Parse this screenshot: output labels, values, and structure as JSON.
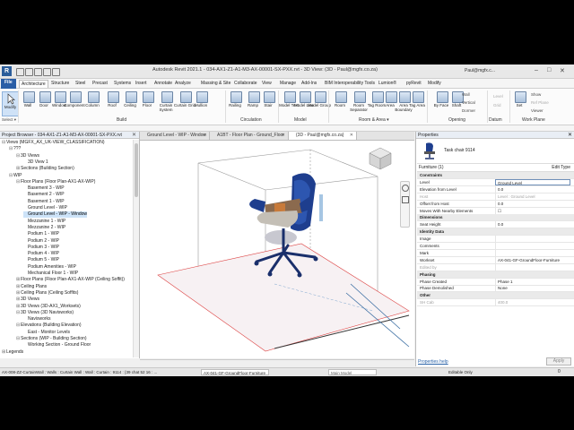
{
  "window": {
    "title": "Autodesk Revit 2021.1 - 034-AX1-Z1-A1-M3-AX-00001-SX-PXX.rvt - 3D View: (3D - Paul@mgfx.co.za)",
    "user": "Paul@mgfx.c...",
    "app_icon": "R"
  },
  "ribbon": {
    "tabs": [
      "File",
      "Architecture",
      "Structure",
      "Steel",
      "Precast",
      "Systems",
      "Insert",
      "Annotate",
      "Analyze",
      "Massing & Site",
      "Collaborate",
      "View",
      "Manage",
      "Add-Ins",
      "BIM Interoperability Tools",
      "Lumion®",
      "pyRevit",
      "Modify"
    ],
    "active_tab": "Architecture",
    "modify": "Modify",
    "select": "Select ▾",
    "buttons": [
      {
        "label": "Wall"
      },
      {
        "label": "Door"
      },
      {
        "label": "Window"
      },
      {
        "label": "Component"
      },
      {
        "label": "Column"
      },
      {
        "label": "Roof"
      },
      {
        "label": "Ceiling"
      },
      {
        "label": "Floor"
      },
      {
        "label": "Curtain System"
      },
      {
        "label": "Curtain Grid"
      },
      {
        "label": "Mullion"
      },
      {
        "label": "Railing"
      },
      {
        "label": "Ramp"
      },
      {
        "label": "Stair"
      },
      {
        "label": "Model Text"
      },
      {
        "label": "Model Line"
      },
      {
        "label": "Model Group"
      },
      {
        "label": "Room"
      },
      {
        "label": "Room Separator"
      },
      {
        "label": "Tag Room"
      },
      {
        "label": "Area"
      },
      {
        "label": "Area Boundary"
      },
      {
        "label": "Tag Area"
      },
      {
        "label": "By Face"
      },
      {
        "label": "Shaft"
      }
    ],
    "opening_small": [
      "Wall",
      "Vertical",
      "Dormer"
    ],
    "datum_small": [
      "Level",
      "Grid"
    ],
    "workplane_small": [
      "Show",
      "Ref Plane",
      "Viewer"
    ],
    "set_label": "Set",
    "panels": [
      "Build",
      "Circulation",
      "Model",
      "Room & Area ▾",
      "Opening",
      "Datum",
      "Work Plane"
    ]
  },
  "browser": {
    "title": "Project Browser - 034-AX1-Z1-A1-M3-AX-00001-SX-PXX.rvt",
    "tree": [
      {
        "label": "Views (MGFX_AX_UK-VIEW_CLASSIFICATION)",
        "indent": 0,
        "tog": "⊟"
      },
      {
        "label": "???",
        "indent": 1,
        "tog": "⊟"
      },
      {
        "label": "3D Views",
        "indent": 2,
        "tog": "⊟"
      },
      {
        "label": "3D View 1",
        "indent": 3,
        "tog": ""
      },
      {
        "label": "Sections (Building Section)",
        "indent": 2,
        "tog": "⊞"
      },
      {
        "label": "WIP",
        "indent": 1,
        "tog": "⊟"
      },
      {
        "label": "Floor Plans (Floor Plan-AX1-AX-WIP)",
        "indent": 2,
        "tog": "⊟"
      },
      {
        "label": "Basement 3 - WIP",
        "indent": 3,
        "tog": ""
      },
      {
        "label": "Basement 2 - WIP",
        "indent": 3,
        "tog": ""
      },
      {
        "label": "Basement 1 - WIP",
        "indent": 3,
        "tog": ""
      },
      {
        "label": "Ground Level - WIP",
        "indent": 3,
        "tog": ""
      },
      {
        "label": "Ground Level - WIP - Window",
        "indent": 3,
        "tog": "",
        "sel": true
      },
      {
        "label": "Mezzanine 1 - WIP",
        "indent": 3,
        "tog": ""
      },
      {
        "label": "Mezzanine 2 - WIP",
        "indent": 3,
        "tog": ""
      },
      {
        "label": "Podium 1 - WIP",
        "indent": 3,
        "tog": ""
      },
      {
        "label": "Podium 2 - WIP",
        "indent": 3,
        "tog": ""
      },
      {
        "label": "Podium 3 - WIP",
        "indent": 3,
        "tog": ""
      },
      {
        "label": "Podium 4 - WIP",
        "indent": 3,
        "tog": ""
      },
      {
        "label": "Podium 5 - WIP",
        "indent": 3,
        "tog": ""
      },
      {
        "label": "Podium Amenities - WIP",
        "indent": 3,
        "tog": ""
      },
      {
        "label": "Mechanical Floor 1 - WIP",
        "indent": 3,
        "tog": ""
      },
      {
        "label": "Floor Plans (Floor Plan-AX1-AX-WIP (Ceiling Soffit))",
        "indent": 2,
        "tog": "⊞"
      },
      {
        "label": "Ceiling Plans",
        "indent": 2,
        "tog": "⊞"
      },
      {
        "label": "Ceiling Plans (Ceiling Soffits)",
        "indent": 2,
        "tog": "⊞"
      },
      {
        "label": "3D Views",
        "indent": 2,
        "tog": "⊞"
      },
      {
        "label": "3D Views (3D-AX1_Worksets)",
        "indent": 2,
        "tog": "⊞"
      },
      {
        "label": "3D Views (3D Navisworks)",
        "indent": 2,
        "tog": "⊟"
      },
      {
        "label": "Navisworks",
        "indent": 3,
        "tog": ""
      },
      {
        "label": "Elevations (Building Elevation)",
        "indent": 2,
        "tog": "⊟"
      },
      {
        "label": "East - Monitor Levels",
        "indent": 3,
        "tog": ""
      },
      {
        "label": "Sections (WIP - Building Section)",
        "indent": 2,
        "tog": "⊟"
      },
      {
        "label": "Working Section - Ground Floor",
        "indent": 3,
        "tog": ""
      },
      {
        "label": "Legends",
        "indent": 0,
        "tog": "⊞"
      }
    ]
  },
  "viewtabs": [
    {
      "label": "Ground Level - WIP - Window"
    },
    {
      "label": "A1BT - Floor Plan - Ground_Floor"
    },
    {
      "label": "{3D - Paul@mgfx.co.za}",
      "active": true
    }
  ],
  "properties": {
    "title": "Properties",
    "type_name": "Task chair 9114",
    "instance": "Furniture (1)",
    "edit_type": "Edit Type",
    "rows": [
      {
        "k": "Constraints",
        "grp": true
      },
      {
        "k": "Level",
        "v": "Ground Level",
        "edit": true
      },
      {
        "k": "Elevation from Level",
        "v": "0.0"
      },
      {
        "k": "Host",
        "v": "Level : Ground Level",
        "dis": true
      },
      {
        "k": "Offset from Host",
        "v": "0.0"
      },
      {
        "k": "Moves With Nearby Elements",
        "v": "☐"
      },
      {
        "k": "Dimensions",
        "grp": true
      },
      {
        "k": "Seat Height",
        "v": "0.0"
      },
      {
        "k": "Identity Data",
        "grp": true
      },
      {
        "k": "Image",
        "v": ""
      },
      {
        "k": "Comments",
        "v": ""
      },
      {
        "k": "Mark",
        "v": ""
      },
      {
        "k": "Workset",
        "v": "AX-041-GF-GroundFloor-Furniture"
      },
      {
        "k": "Edited by",
        "v": "",
        "dis": true
      },
      {
        "k": "Phasing",
        "grp": true
      },
      {
        "k": "Phase Created",
        "v": "Phase 1"
      },
      {
        "k": "Phase Demolished",
        "v": "None"
      },
      {
        "k": "Other",
        "grp": true
      },
      {
        "k": "SH Cab",
        "v": "400.0",
        "dis": true
      }
    ],
    "help": "Properties help",
    "apply": "Apply"
  },
  "status": {
    "text": "AX-008-ZZ-CurtainWall : Walls : Curtain Wall : Wall : Curtain : 9114 : {39 chat 52 16 : ...",
    "workset": "AX-041-GF-GroundFloor-Furniture",
    "model": "Main Model",
    "editable": "Editable Only",
    "filter_count": "0"
  },
  "colors": {
    "accent": "#2a5ea6",
    "chair": "#1a3c8c",
    "selection": "#cde3f8"
  }
}
